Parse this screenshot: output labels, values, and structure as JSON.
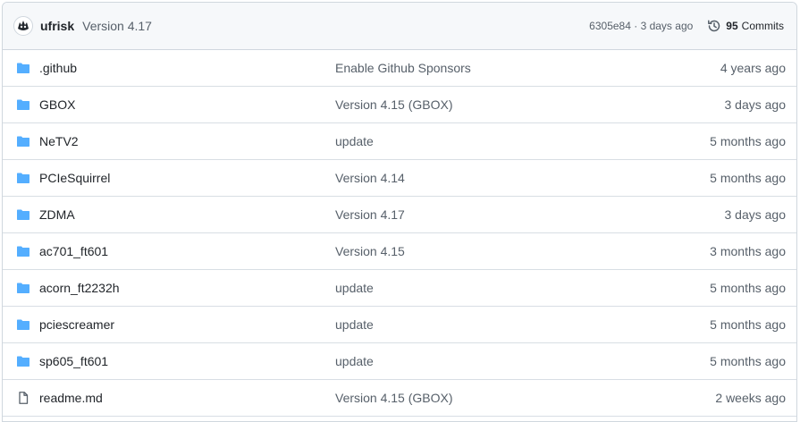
{
  "header": {
    "author": "ufrisk",
    "message": "Version 4.17",
    "sha": "6305e84",
    "separator": "·",
    "sha_age": "3 days ago",
    "commit_count": "95",
    "commits_label": "Commits"
  },
  "files": [
    {
      "name": ".github",
      "type": "folder",
      "message": "Enable Github Sponsors",
      "age": "4 years ago"
    },
    {
      "name": "GBOX",
      "type": "folder",
      "message": "Version 4.15 (GBOX)",
      "age": "3 days ago"
    },
    {
      "name": "NeTV2",
      "type": "folder",
      "message": "update",
      "age": "5 months ago"
    },
    {
      "name": "PCIeSquirrel",
      "type": "folder",
      "message": "Version 4.14",
      "age": "5 months ago"
    },
    {
      "name": "ZDMA",
      "type": "folder",
      "message": "Version 4.17",
      "age": "3 days ago"
    },
    {
      "name": "ac701_ft601",
      "type": "folder",
      "message": "Version 4.15",
      "age": "3 months ago"
    },
    {
      "name": "acorn_ft2232h",
      "type": "folder",
      "message": "update",
      "age": "5 months ago"
    },
    {
      "name": "pciescreamer",
      "type": "folder",
      "message": "update",
      "age": "5 months ago"
    },
    {
      "name": "sp605_ft601",
      "type": "folder",
      "message": "update",
      "age": "5 months ago"
    },
    {
      "name": "readme.md",
      "type": "file",
      "message": "Version 4.15 (GBOX)",
      "age": "2 weeks ago"
    }
  ],
  "colors": {
    "folder": "#54aeff",
    "file": "#57606a",
    "border": "#d0d7de",
    "header_bg": "#f6f8fa"
  }
}
